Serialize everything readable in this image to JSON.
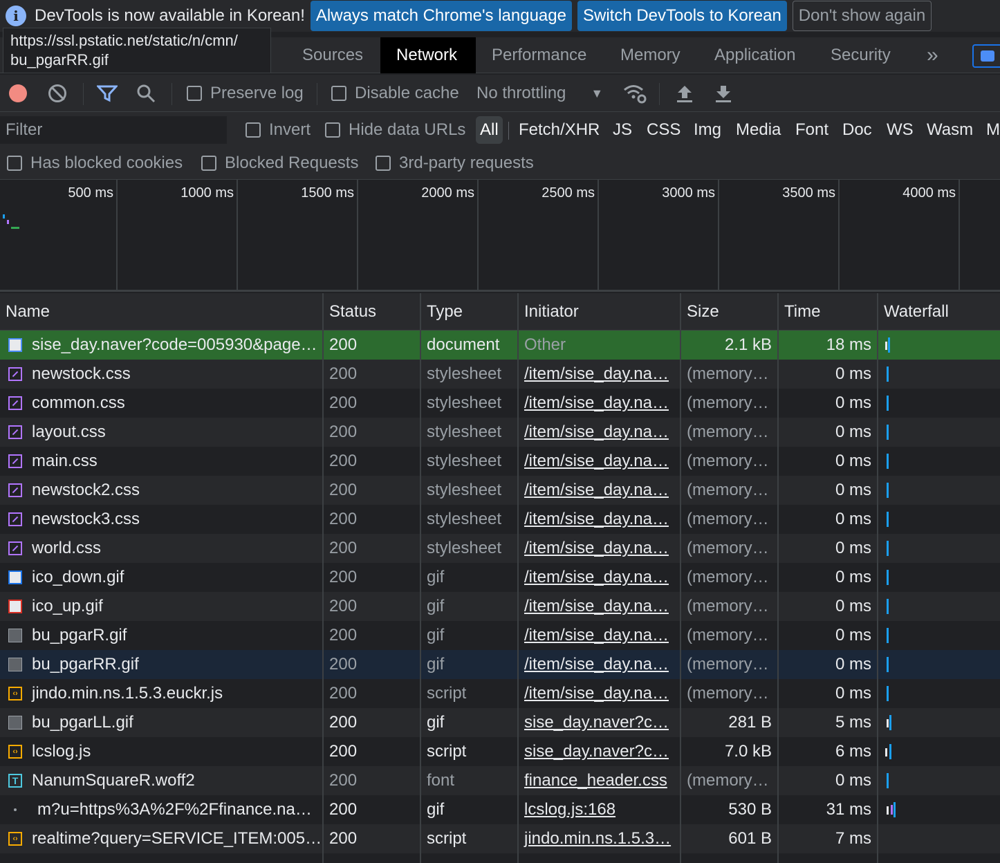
{
  "infobar": {
    "message": "DevTools is now available in Korean!",
    "btn_match": "Always match Chrome's language",
    "btn_switch": "Switch DevTools to Korean",
    "btn_dismiss": "Don't show again"
  },
  "tooltip": {
    "line1": "https://ssl.pstatic.net/static/n/cmn/",
    "line2": "bu_pgarRR.gif"
  },
  "tabs": [
    "Sources",
    "Network",
    "Performance",
    "Memory",
    "Application",
    "Security"
  ],
  "active_tab": "Network",
  "toolbar": {
    "preserve_log": "Preserve log",
    "disable_cache": "Disable cache",
    "throttling": "No throttling"
  },
  "filter": {
    "placeholder": "Filter",
    "invert": "Invert",
    "hide_data_urls": "Hide data URLs",
    "types": [
      "All",
      "Fetch/XHR",
      "JS",
      "CSS",
      "Img",
      "Media",
      "Font",
      "Doc",
      "WS",
      "Wasm",
      "M"
    ],
    "has_blocked_cookies": "Has blocked cookies",
    "blocked_requests": "Blocked Requests",
    "third_party": "3rd-party requests"
  },
  "overview": {
    "ticks": [
      "500 ms",
      "1000 ms",
      "1500 ms",
      "2000 ms",
      "2500 ms",
      "3000 ms",
      "3500 ms",
      "4000 ms"
    ]
  },
  "columns": [
    "Name",
    "Status",
    "Type",
    "Initiator",
    "Size",
    "Time",
    "Waterfall"
  ],
  "rows": [
    {
      "name": "sise_day.naver?code=005930&page…",
      "status": "200",
      "type": "document",
      "initiator": "Other",
      "size": "2.1 kB",
      "time": "18 ms",
      "icon": "document-icon"
    },
    {
      "name": "newstock.css",
      "status": "200",
      "type": "stylesheet",
      "initiator": "/item/sise_day.na…",
      "size": "(memory…",
      "time": "0 ms",
      "icon": "stylesheet-icon"
    },
    {
      "name": "common.css",
      "status": "200",
      "type": "stylesheet",
      "initiator": "/item/sise_day.na…",
      "size": "(memory…",
      "time": "0 ms",
      "icon": "stylesheet-icon"
    },
    {
      "name": "layout.css",
      "status": "200",
      "type": "stylesheet",
      "initiator": "/item/sise_day.na…",
      "size": "(memory…",
      "time": "0 ms",
      "icon": "stylesheet-icon"
    },
    {
      "name": "main.css",
      "status": "200",
      "type": "stylesheet",
      "initiator": "/item/sise_day.na…",
      "size": "(memory…",
      "time": "0 ms",
      "icon": "stylesheet-icon"
    },
    {
      "name": "newstock2.css",
      "status": "200",
      "type": "stylesheet",
      "initiator": "/item/sise_day.na…",
      "size": "(memory…",
      "time": "0 ms",
      "icon": "stylesheet-icon"
    },
    {
      "name": "newstock3.css",
      "status": "200",
      "type": "stylesheet",
      "initiator": "/item/sise_day.na…",
      "size": "(memory…",
      "time": "0 ms",
      "icon": "stylesheet-icon"
    },
    {
      "name": "world.css",
      "status": "200",
      "type": "stylesheet",
      "initiator": "/item/sise_day.na…",
      "size": "(memory…",
      "time": "0 ms",
      "icon": "stylesheet-icon"
    },
    {
      "name": "ico_down.gif",
      "status": "200",
      "type": "gif",
      "initiator": "/item/sise_day.na…",
      "size": "(memory…",
      "time": "0 ms",
      "icon": "image-down-icon"
    },
    {
      "name": "ico_up.gif",
      "status": "200",
      "type": "gif",
      "initiator": "/item/sise_day.na…",
      "size": "(memory…",
      "time": "0 ms",
      "icon": "image-up-icon"
    },
    {
      "name": "bu_pgarR.gif",
      "status": "200",
      "type": "gif",
      "initiator": "/item/sise_day.na…",
      "size": "(memory…",
      "time": "0 ms",
      "icon": "image-icon"
    },
    {
      "name": "bu_pgarRR.gif",
      "status": "200",
      "type": "gif",
      "initiator": "/item/sise_day.na…",
      "size": "(memory…",
      "time": "0 ms",
      "icon": "image-icon"
    },
    {
      "name": "jindo.min.ns.1.5.3.euckr.js",
      "status": "200",
      "type": "script",
      "initiator": "/item/sise_day.na…",
      "size": "(memory…",
      "time": "0 ms",
      "icon": "script-icon"
    },
    {
      "name": "bu_pgarLL.gif",
      "status": "200",
      "type": "gif",
      "initiator": "sise_day.naver?c…",
      "size": "281 B",
      "time": "5 ms",
      "icon": "image-icon"
    },
    {
      "name": "lcslog.js",
      "status": "200",
      "type": "script",
      "initiator": "sise_day.naver?c…",
      "size": "7.0 kB",
      "time": "6 ms",
      "icon": "script-icon"
    },
    {
      "name": "NanumSquareR.woff2",
      "status": "200",
      "type": "font",
      "initiator": "finance_header.css",
      "size": "(memory…",
      "time": "0 ms",
      "icon": "font-icon"
    },
    {
      "name": "m?u=https%3A%2F%2Ffinance.na…",
      "status": "200",
      "type": "gif",
      "initiator": "lcslog.js:168",
      "size": "530 B",
      "time": "31 ms",
      "icon": "pixel-icon"
    },
    {
      "name": "realtime?query=SERVICE_ITEM:005…",
      "status": "200",
      "type": "script",
      "initiator": "jindo.min.ns.1.5.3…",
      "size": "601 B",
      "time": "7 ms",
      "icon": "script-icon"
    }
  ]
}
